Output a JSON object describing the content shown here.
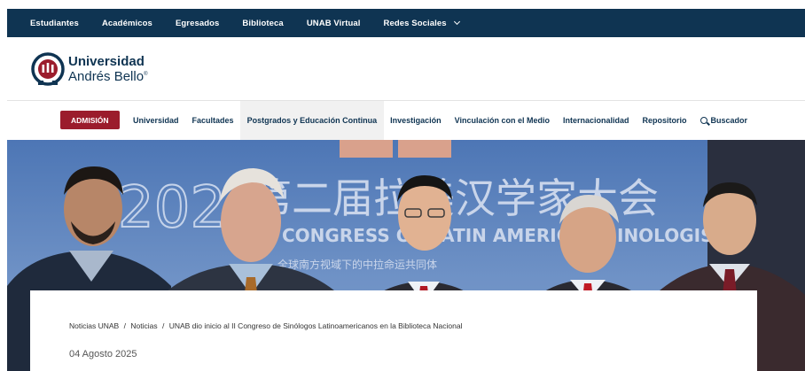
{
  "topbar": {
    "items": [
      "Estudiantes",
      "Académicos",
      "Egresados",
      "Biblioteca",
      "UNAB Virtual",
      "Redes Sociales"
    ]
  },
  "logo": {
    "line1": "Universidad",
    "line2": "Andrés Bello",
    "mark": "®",
    "colors": {
      "brand": "#0f3452",
      "accent": "#9b1c2c"
    }
  },
  "nav": {
    "admision": "ADMISIÓN",
    "items": [
      "Universidad",
      "Facultades",
      "Postgrados y Educación Continua",
      "Investigación",
      "Vinculación con el Medio",
      "Internacionalidad",
      "Repositorio"
    ],
    "search": "Buscador"
  },
  "hero": {
    "banner_year": "2024",
    "banner_cn": "第二届拉美汉学家大会",
    "banner_en": "CONGRESS OF LATIN AMERICAN SINOLOGISTS",
    "banner_sub_cn": "全球南方视域下的中拉命运共同体"
  },
  "article": {
    "breadcrumb": [
      "Noticias UNAB",
      "Noticias",
      "UNAB dio inicio al II Congreso de Sinólogos Latinoamericanos en la Biblioteca Nacional"
    ],
    "date": "04 Agosto 2025"
  }
}
